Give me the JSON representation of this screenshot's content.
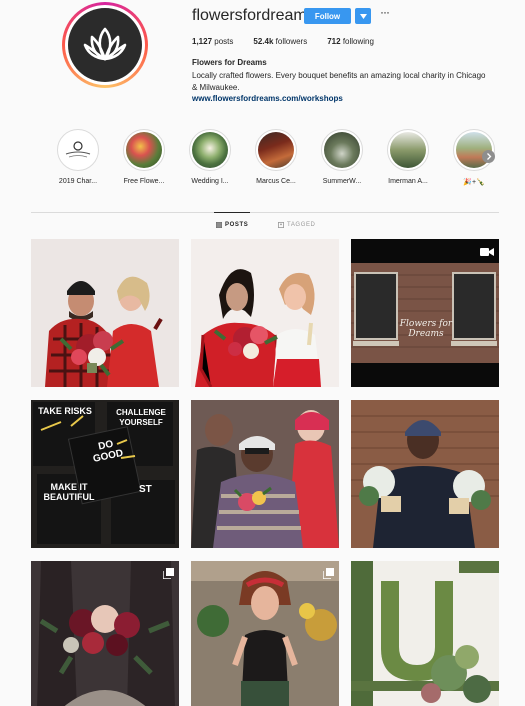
{
  "profile": {
    "username": "flowersfordreams",
    "follow_label": "Follow",
    "more_label": "···",
    "stats": {
      "posts_count": "1,127",
      "posts_label": "posts",
      "followers_count": "52.4k",
      "followers_label": "followers",
      "following_count": "712",
      "following_label": "following"
    },
    "bio_name": "Flowers for Dreams",
    "bio_text": "Locally crafted flowers. Every bouquet benefits an amazing local charity in Chicago & Milwaukee.",
    "bio_link": "www.flowersfordreams.com/workshops"
  },
  "highlights": [
    {
      "label": "2019 Char..."
    },
    {
      "label": "Free Flowe..."
    },
    {
      "label": "Wedding I..."
    },
    {
      "label": "Marcus Ce..."
    },
    {
      "label": "SummerW..."
    },
    {
      "label": "Imerman A..."
    },
    {
      "label": "🎉+🍾"
    }
  ],
  "tabs": {
    "posts_label": "POSTS",
    "tagged_label": "TAGGED"
  },
  "posts": [
    {
      "type": "photo"
    },
    {
      "type": "photo"
    },
    {
      "type": "video",
      "overlay_text": "Flowers for Dreams"
    },
    {
      "type": "photo",
      "poster_texts": [
        "TAKE RISKS",
        "CHALLENGE YOURSELF",
        "DO GOOD",
        "MAKE IT BEAUTIFUL",
        "ST"
      ]
    },
    {
      "type": "photo"
    },
    {
      "type": "photo"
    },
    {
      "type": "carousel"
    },
    {
      "type": "carousel"
    },
    {
      "type": "photo"
    }
  ]
}
